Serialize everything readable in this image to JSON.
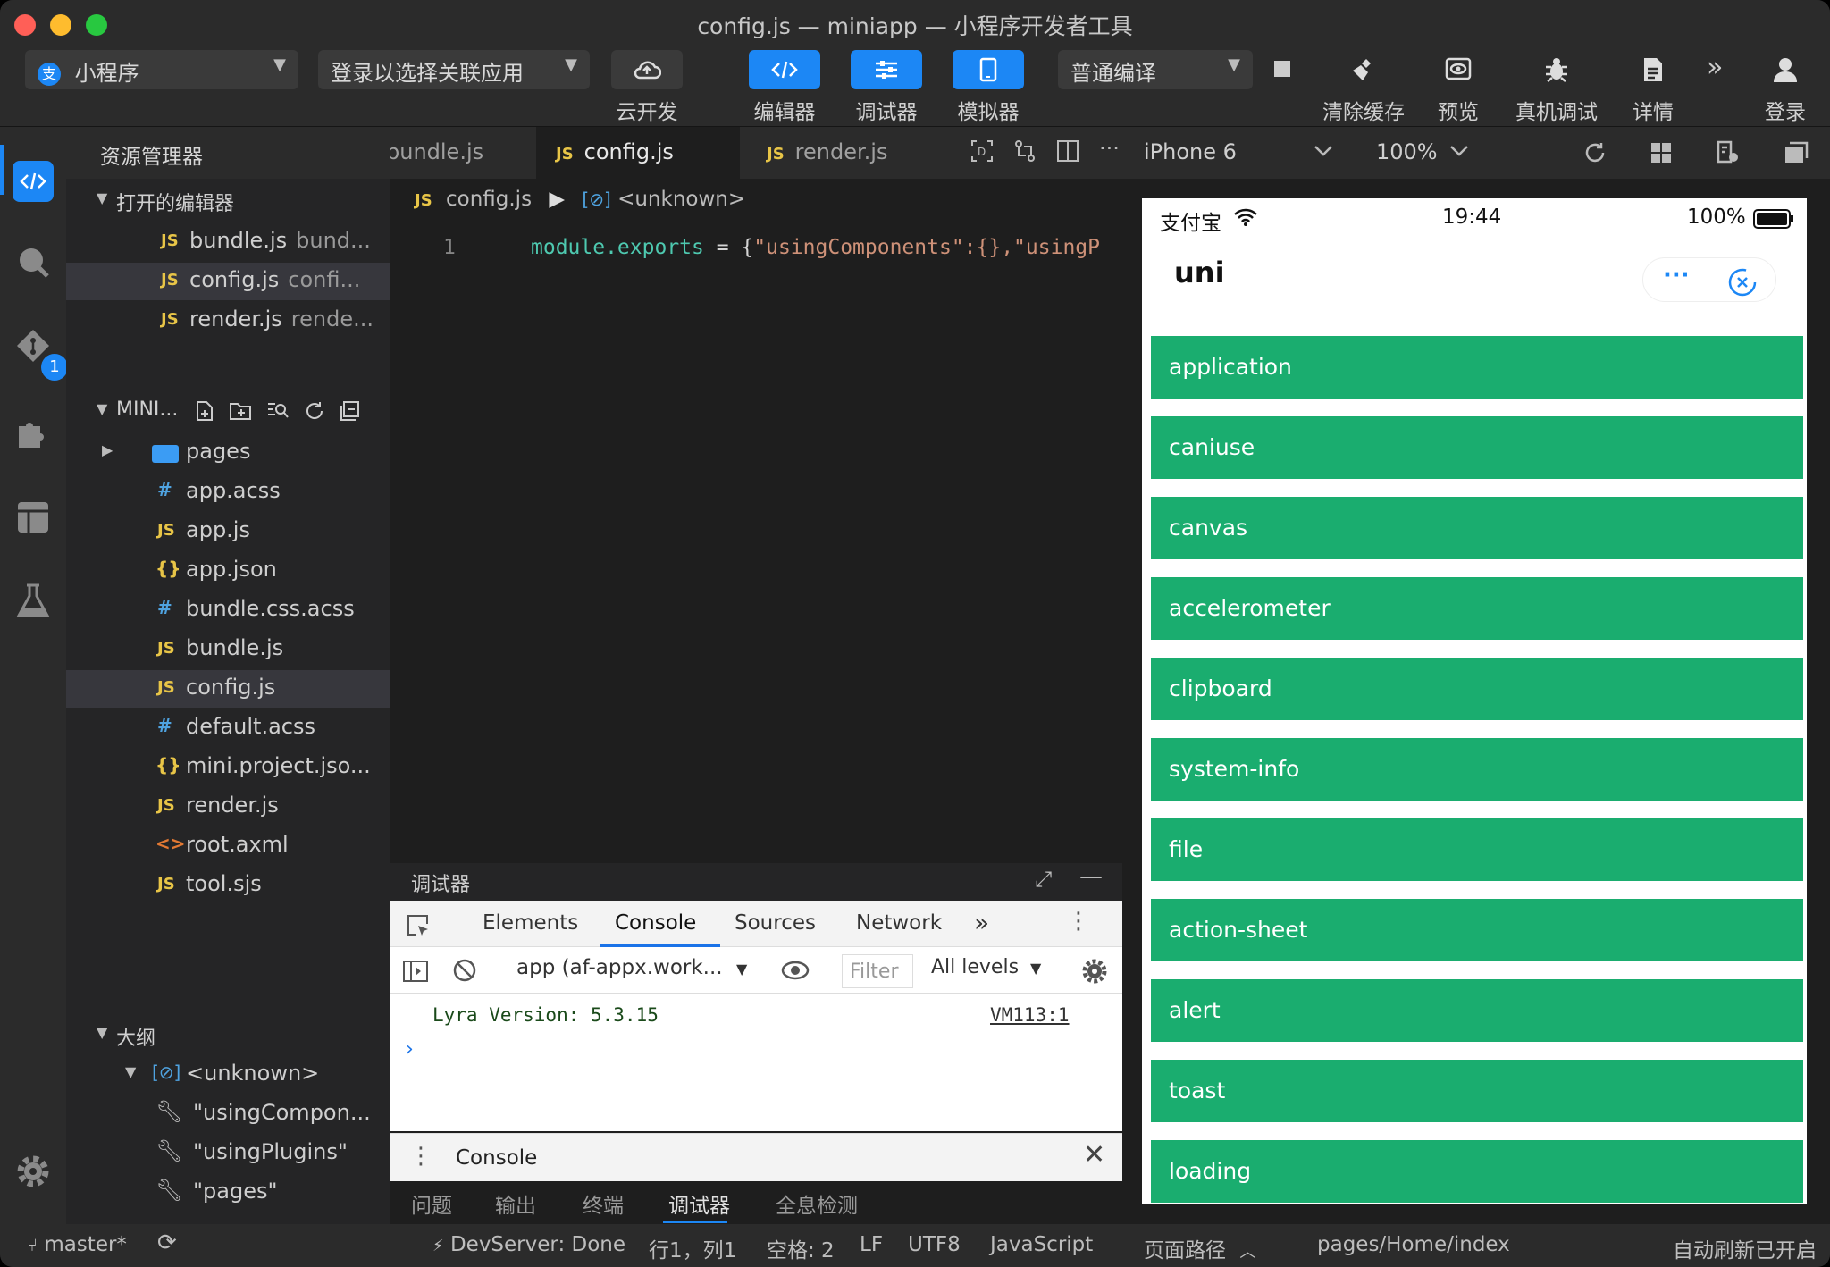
{
  "window": {
    "title": "config.js — miniapp — 小程序开发者工具"
  },
  "toolbar": {
    "app_select": "小程序",
    "link_app": "登录以选择关联应用",
    "cloud": "云开发",
    "editor": "编辑器",
    "debugger": "调试器",
    "simulator": "模拟器",
    "compile_mode": "普通编译",
    "clear_cache": "清除缓存",
    "preview": "预览",
    "remote_debug": "真机调试",
    "details": "详情",
    "login": "登录"
  },
  "activity": {
    "badge": "1"
  },
  "sidebar": {
    "title": "资源管理器",
    "open_editors_label": "打开的编辑器",
    "open_editors": [
      {
        "name": "bundle.js",
        "sub": "bund..."
      },
      {
        "name": "config.js",
        "sub": "confi..."
      },
      {
        "name": "render.js",
        "sub": "rende..."
      }
    ],
    "project_label": "MINI...",
    "files": [
      {
        "icon": "",
        "name": "pages"
      },
      {
        "icon": "#",
        "name": "app.acss"
      },
      {
        "icon": "JS",
        "name": "app.js"
      },
      {
        "icon": "{}",
        "name": "app.json"
      },
      {
        "icon": "#",
        "name": "bundle.css.acss"
      },
      {
        "icon": "JS",
        "name": "bundle.js"
      },
      {
        "icon": "JS",
        "name": "config.js"
      },
      {
        "icon": "#",
        "name": "default.acss"
      },
      {
        "icon": "{}",
        "name": "mini.project.jso..."
      },
      {
        "icon": "JS",
        "name": "render.js"
      },
      {
        "icon": "<>",
        "name": "root.axml"
      },
      {
        "icon": "JS",
        "name": "tool.sjs"
      }
    ],
    "outline_label": "大纲",
    "outline_root": "<unknown>",
    "outline_items": [
      "\"usingCompon...",
      "\"usingPlugins\"",
      "\"pages\""
    ]
  },
  "editor": {
    "tabs": [
      "bundle.js",
      "config.js",
      "render.js"
    ],
    "breadcrumb_file": "config.js",
    "breadcrumb_symbol": "<unknown>",
    "line_number": "1",
    "code_part1": "module.exports",
    "code_part2": " = {",
    "code_part3": "\"usingComponents\":{},\"usingP"
  },
  "debug_panel": {
    "title": "调试器",
    "tabs": [
      "Elements",
      "Console",
      "Sources",
      "Network",
      "»"
    ],
    "context": "app (af-appx.work...",
    "filter_placeholder": "Filter",
    "levels": "All levels",
    "console_message": "Lyra Version: 5.3.15",
    "console_source": "VM113:1",
    "prompt": "›",
    "drawer_tab": "Console"
  },
  "bottom_tabs": [
    "问题",
    "输出",
    "终端",
    "调试器",
    "全息检测"
  ],
  "simulator": {
    "device": "iPhone 6",
    "zoom": "100%",
    "carrier": "支付宝",
    "time": "19:44",
    "battery": "100%",
    "page_title": "uni",
    "items": [
      "application",
      "caniuse",
      "canvas",
      "accelerometer",
      "clipboard",
      "system-info",
      "file",
      "action-sheet",
      "alert",
      "toast",
      "loading"
    ]
  },
  "statusbar": {
    "branch": "master*",
    "devserver": "DevServer: Done",
    "cursor": "行1，列1",
    "spaces": "空格: 2",
    "eol": "LF",
    "encoding": "UTF8",
    "language": "JavaScript",
    "page_path_label": "页面路径",
    "page_path": "pages/Home/index",
    "auto_refresh": "自动刷新已开启"
  },
  "colors": {
    "accent": "#1c87f5",
    "list_item": "#1aad6f"
  }
}
